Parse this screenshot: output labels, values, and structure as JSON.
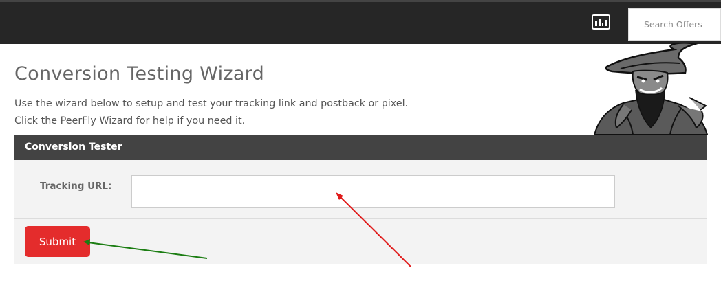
{
  "header": {
    "stats_icon": "bar-chart-icon",
    "search_placeholder": "Search Offers"
  },
  "page": {
    "title": "Conversion Testing Wizard",
    "intro_line1": "Use the wizard below to setup and test your tracking link and postback or pixel.",
    "intro_line2": "Click the PeerFly Wizard for help if you need it."
  },
  "mascot": {
    "icon": "wizard-mascot"
  },
  "panel": {
    "title": "Conversion Tester",
    "tracking_label": "Tracking URL:",
    "tracking_value": "",
    "submit_label": "Submit"
  },
  "annotations": {
    "red_arrow_color": "#e01b1b",
    "green_arrow_color": "#1b7d12"
  },
  "colors": {
    "topbar": "#262626",
    "panel_header": "#434343",
    "submit": "#e42c2c"
  }
}
